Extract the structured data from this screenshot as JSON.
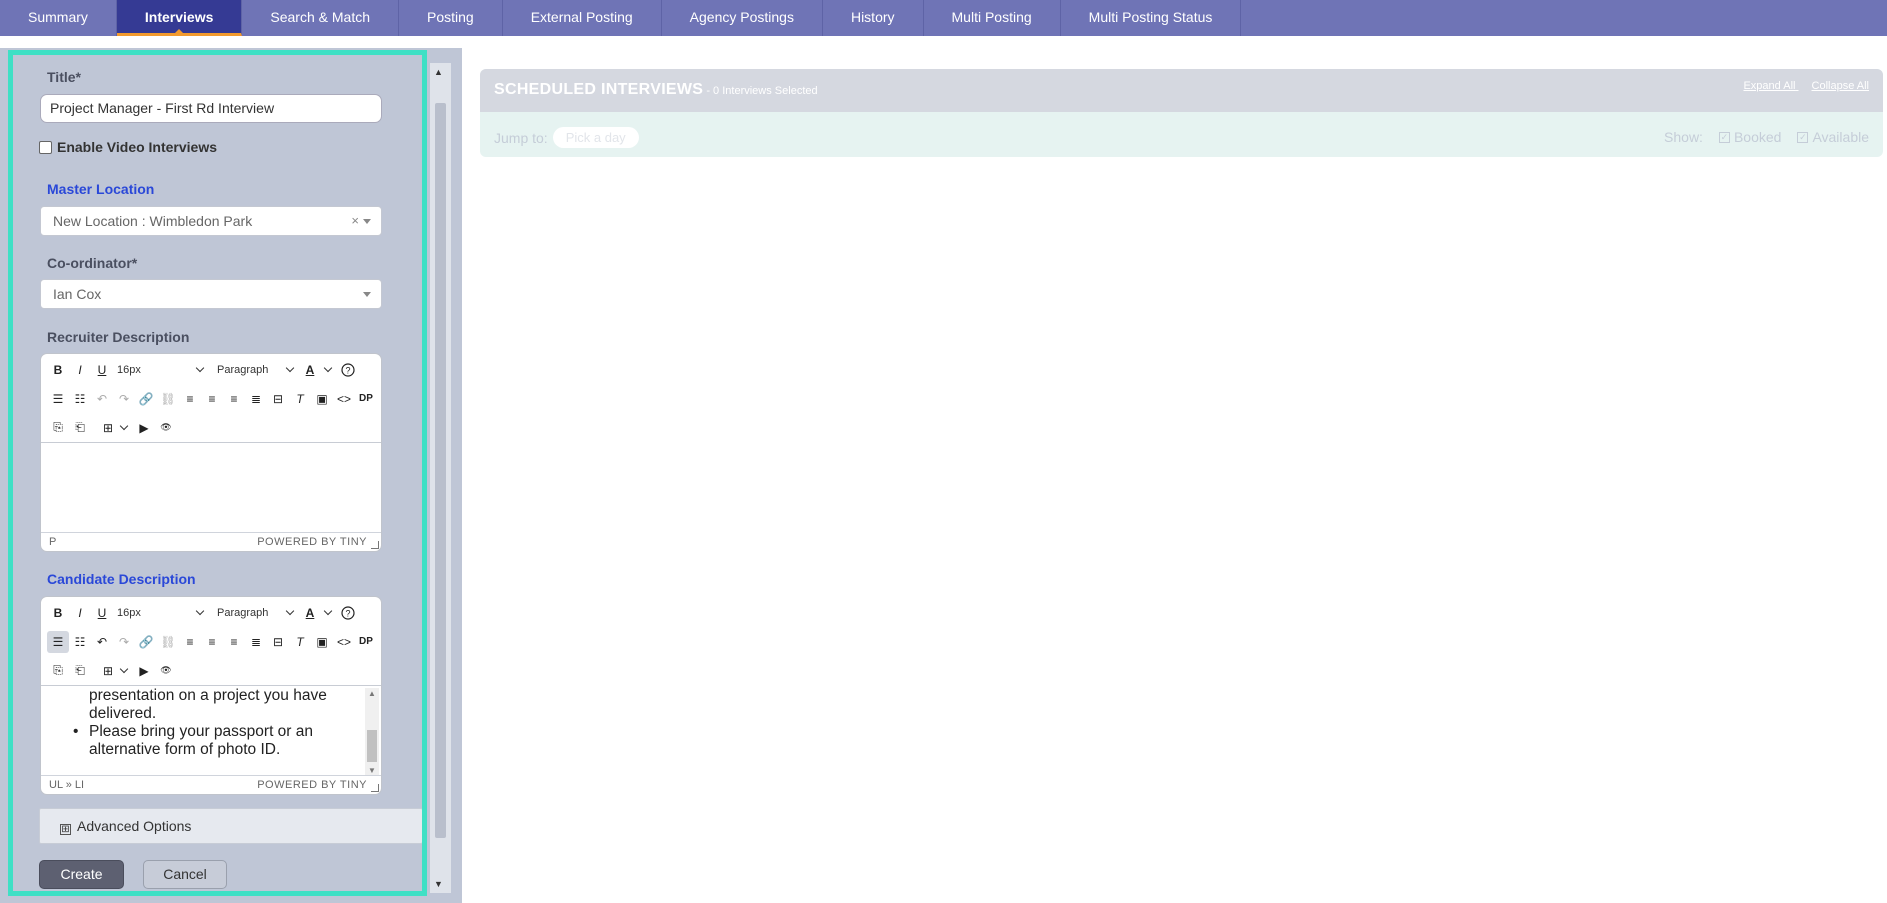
{
  "tabs": [
    {
      "label": "Summary",
      "active": false
    },
    {
      "label": "Interviews",
      "active": true
    },
    {
      "label": "Search & Match",
      "active": false
    },
    {
      "label": "Posting",
      "active": false
    },
    {
      "label": "External Posting",
      "active": false
    },
    {
      "label": "Agency Postings",
      "active": false
    },
    {
      "label": "History",
      "active": false
    },
    {
      "label": "Multi Posting",
      "active": false
    },
    {
      "label": "Multi Posting Status",
      "active": false
    }
  ],
  "form": {
    "title_label": "Title*",
    "title_value": "Project Manager - First Rd Interview",
    "video_label": "Enable Video Interviews",
    "video_checked": false,
    "master_location_label": "Master Location",
    "master_location_value": "New Location : Wimbledon Park",
    "clear_symbol": "×",
    "coordinator_label": "Co-ordinator*",
    "coordinator_value": "Ian Cox",
    "recruiter_label": "Recruiter Description",
    "candidate_label": "Candidate Description",
    "advanced_label": "Advanced Options",
    "advanced_icon": "⊞",
    "create_label": "Create",
    "cancel_label": "Cancel"
  },
  "editor": {
    "font_size": "16px",
    "block_format": "Paragraph",
    "dp_label": "DP",
    "powered_by": "POWERED BY TINY"
  },
  "recruiter_editor": {
    "status_path": "P"
  },
  "candidate_editor": {
    "status_path": "UL » LI",
    "lines": [
      "presentation on a project you have",
      "delivered.",
      "Please bring your passport or an",
      "alternative form of photo ID."
    ]
  },
  "schedule": {
    "title": "SCHEDULED INTERVIEWS",
    "subtitle": " - 0 Interviews Selected",
    "expand_all": "Expand All",
    "collapse_all": "Collapse All",
    "jump_to_label": "Jump to:",
    "pick_day_placeholder": "Pick a day",
    "show_label": "Show:",
    "booked_label": "Booked",
    "available_label": "Available",
    "check_mark": "✓"
  },
  "colors": {
    "tab_bar": "#6f74b6",
    "tab_active": "#353a94",
    "tab_accent": "#f29a2e",
    "panel_border": "#3fe0c5",
    "panel_bg": "#bfc6d6",
    "blue_label": "#2a48d8"
  }
}
